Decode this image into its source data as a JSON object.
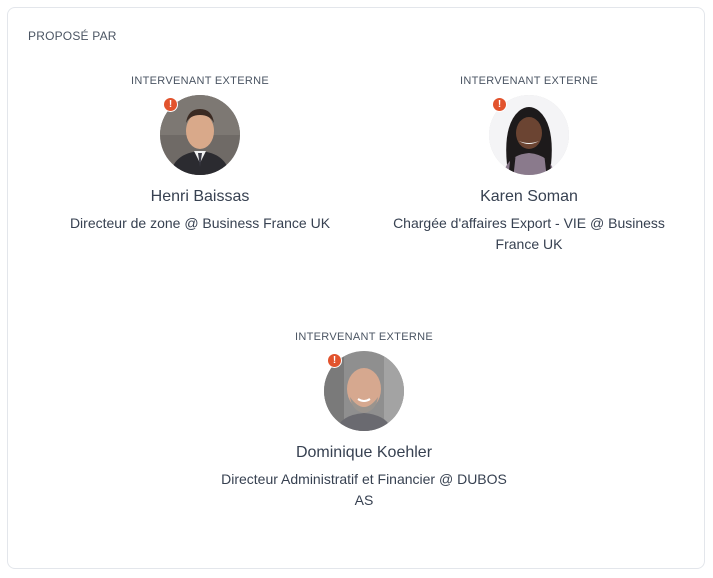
{
  "section": {
    "title": "PROPOSÉ PAR"
  },
  "speakers": [
    {
      "role": "INTERVENANT EXTERNE",
      "name": "Henri Baissas",
      "title": "Directeur de zone @ Business France UK",
      "avatar_icon": "person-photo",
      "alert_icon": "alert-icon",
      "alert_glyph": "!"
    },
    {
      "role": "INTERVENANT EXTERNE",
      "name": "Karen Soman",
      "title": "Chargée d'affaires Export - VIE @ Business France UK",
      "avatar_icon": "person-photo",
      "alert_icon": "alert-icon",
      "alert_glyph": "!"
    },
    {
      "role": "INTERVENANT EXTERNE",
      "name": "Dominique Koehler",
      "title": "Directeur Administratif et Financier @ DUBOS AS",
      "avatar_icon": "person-photo",
      "alert_icon": "alert-icon",
      "alert_glyph": "!"
    }
  ],
  "colors": {
    "alert": "#e2532d",
    "text": "#374151",
    "muted": "#4b5563",
    "border": "#e3e6eb"
  }
}
